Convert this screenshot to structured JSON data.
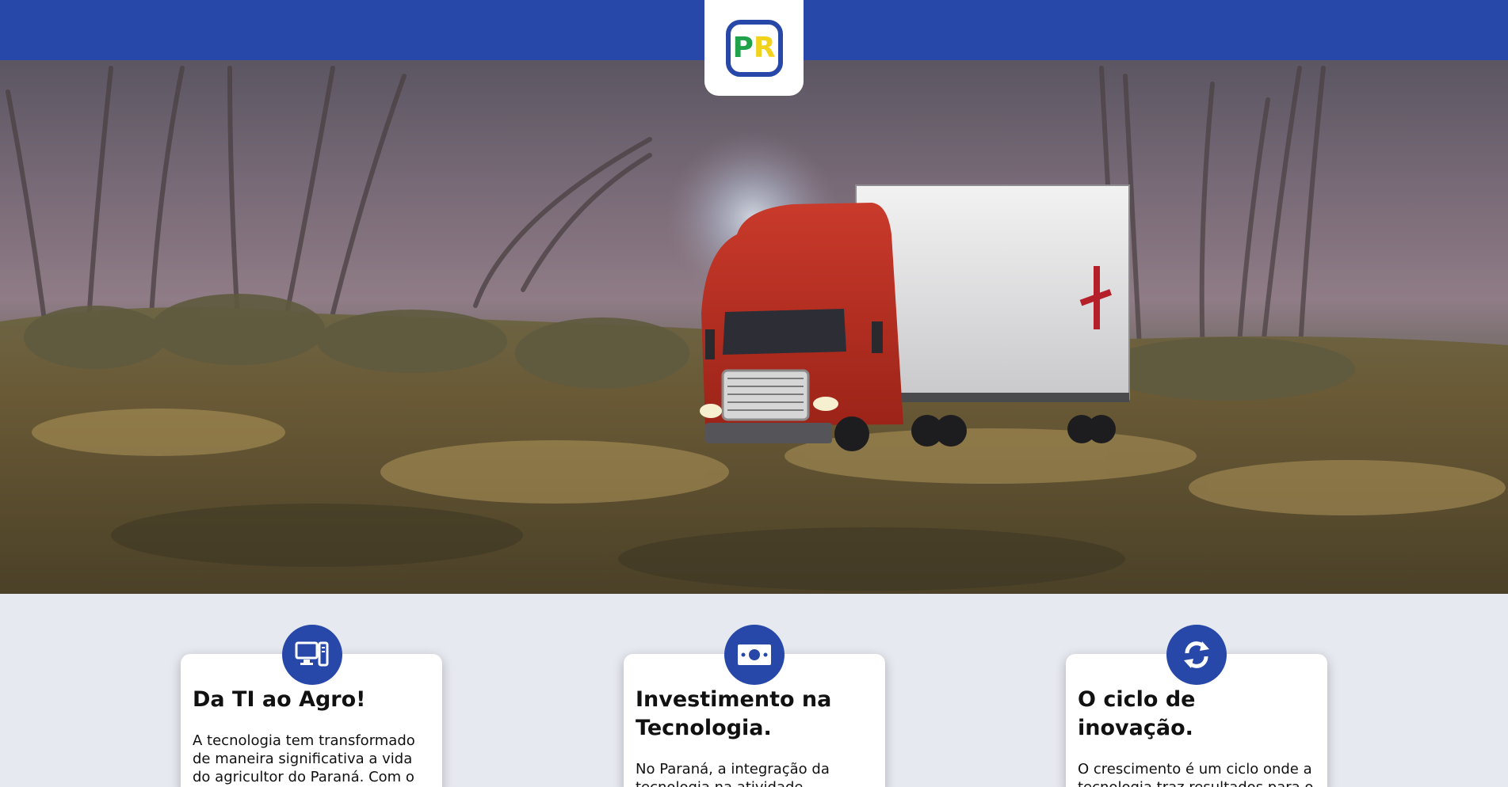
{
  "header": {
    "logo_letter_1": "P",
    "logo_letter_2": "R",
    "bar_color": "#2748a8",
    "logo_p_color": "#1fa24a",
    "logo_r_color": "#f2d21a"
  },
  "hero": {
    "image_description_icon": "truck-in-field-image"
  },
  "cards": [
    {
      "icon": "computer-icon",
      "title": "Da TI ao Agro!",
      "text": "A tecnologia tem transformado de maneira significativa a vida do agricultor do Paraná. Com o"
    },
    {
      "icon": "money-icon",
      "title": "Investimento na Tecnologia.",
      "text": "No Paraná, a integração da tecnologia na atividade"
    },
    {
      "icon": "refresh-cycle-icon",
      "title": "O ciclo de inovação.",
      "text": "O crescimento é um ciclo onde a tecnologia traz resultados para o agricultor, e é com esse"
    }
  ]
}
